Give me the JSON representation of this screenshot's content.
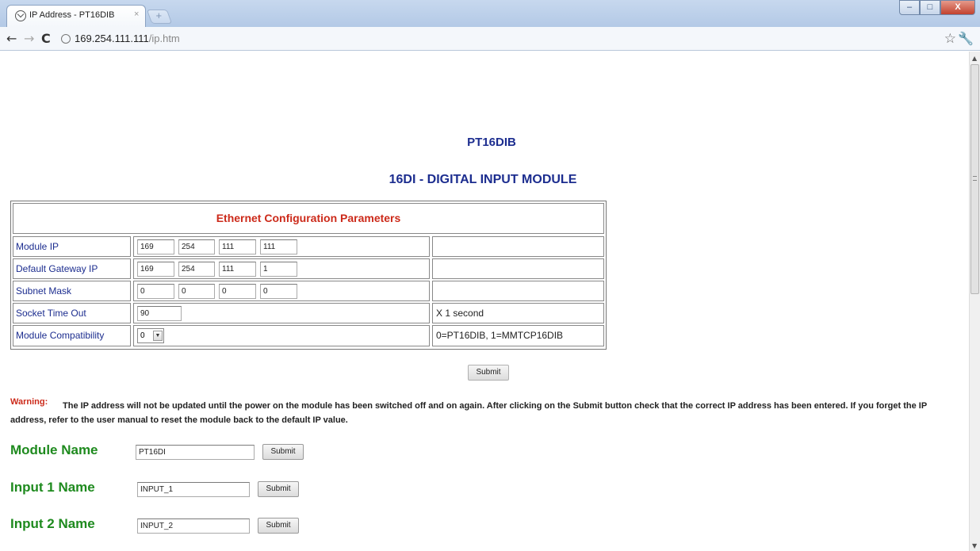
{
  "browser": {
    "tab_title": "IP Address - PT16DIB",
    "tab_close": "×",
    "new_tab_symbol": "+",
    "window_buttons": [
      "–",
      "□",
      "X"
    ],
    "url_host": "169.254.111.111",
    "url_path": "/ip.htm",
    "icons": [
      "back-arrow-icon",
      "forward-arrow-icon",
      "reload-icon",
      "page-icon",
      "star-icon",
      "wrench-icon"
    ]
  },
  "page": {
    "model": "PT16DIB",
    "module_title": "16DI - DIGITAL INPUT MODULE",
    "config": {
      "title": "Ethernet Configuration Parameters",
      "rows": {
        "module_ip": {
          "label": "Module IP",
          "octets": [
            "169",
            "254",
            "111",
            "111"
          ],
          "note": ""
        },
        "gateway_ip": {
          "label": "Default Gateway IP",
          "octets": [
            "169",
            "254",
            "111",
            "1"
          ],
          "note": ""
        },
        "subnet_mask": {
          "label": "Subnet Mask",
          "octets": [
            "0",
            "0",
            "0",
            "0"
          ],
          "note": ""
        },
        "socket_timeout": {
          "label": "Socket Time Out",
          "value": "90",
          "note": "X 1 second"
        },
        "compatibility": {
          "label": "Module Compatibility",
          "value": "0",
          "note": "0=PT16DIB,  1=MMTCP16DIB"
        }
      }
    },
    "submit_label": "Submit",
    "warning_label": "Warning:",
    "warning_text": "The IP address will not be updated until the power on the module has been switched off and on again. After clicking on the Submit button check that the correct IP address has been entered. If you forget the IP address, refer to the user manual to reset the module back to the default IP value.",
    "names": {
      "module": {
        "label": "Module Name",
        "value": "PT16DI",
        "button": "Submit"
      },
      "input1": {
        "label": "Input 1 Name",
        "value": "INPUT_1",
        "button": "Submit"
      },
      "input2": {
        "label": "Input 2 Name",
        "value": "INPUT_2",
        "button": "Submit"
      }
    }
  },
  "colors": {
    "heading_blue": "#1c2d8f",
    "title_red": "#cc2a1a",
    "name_green": "#1e8a1e"
  }
}
